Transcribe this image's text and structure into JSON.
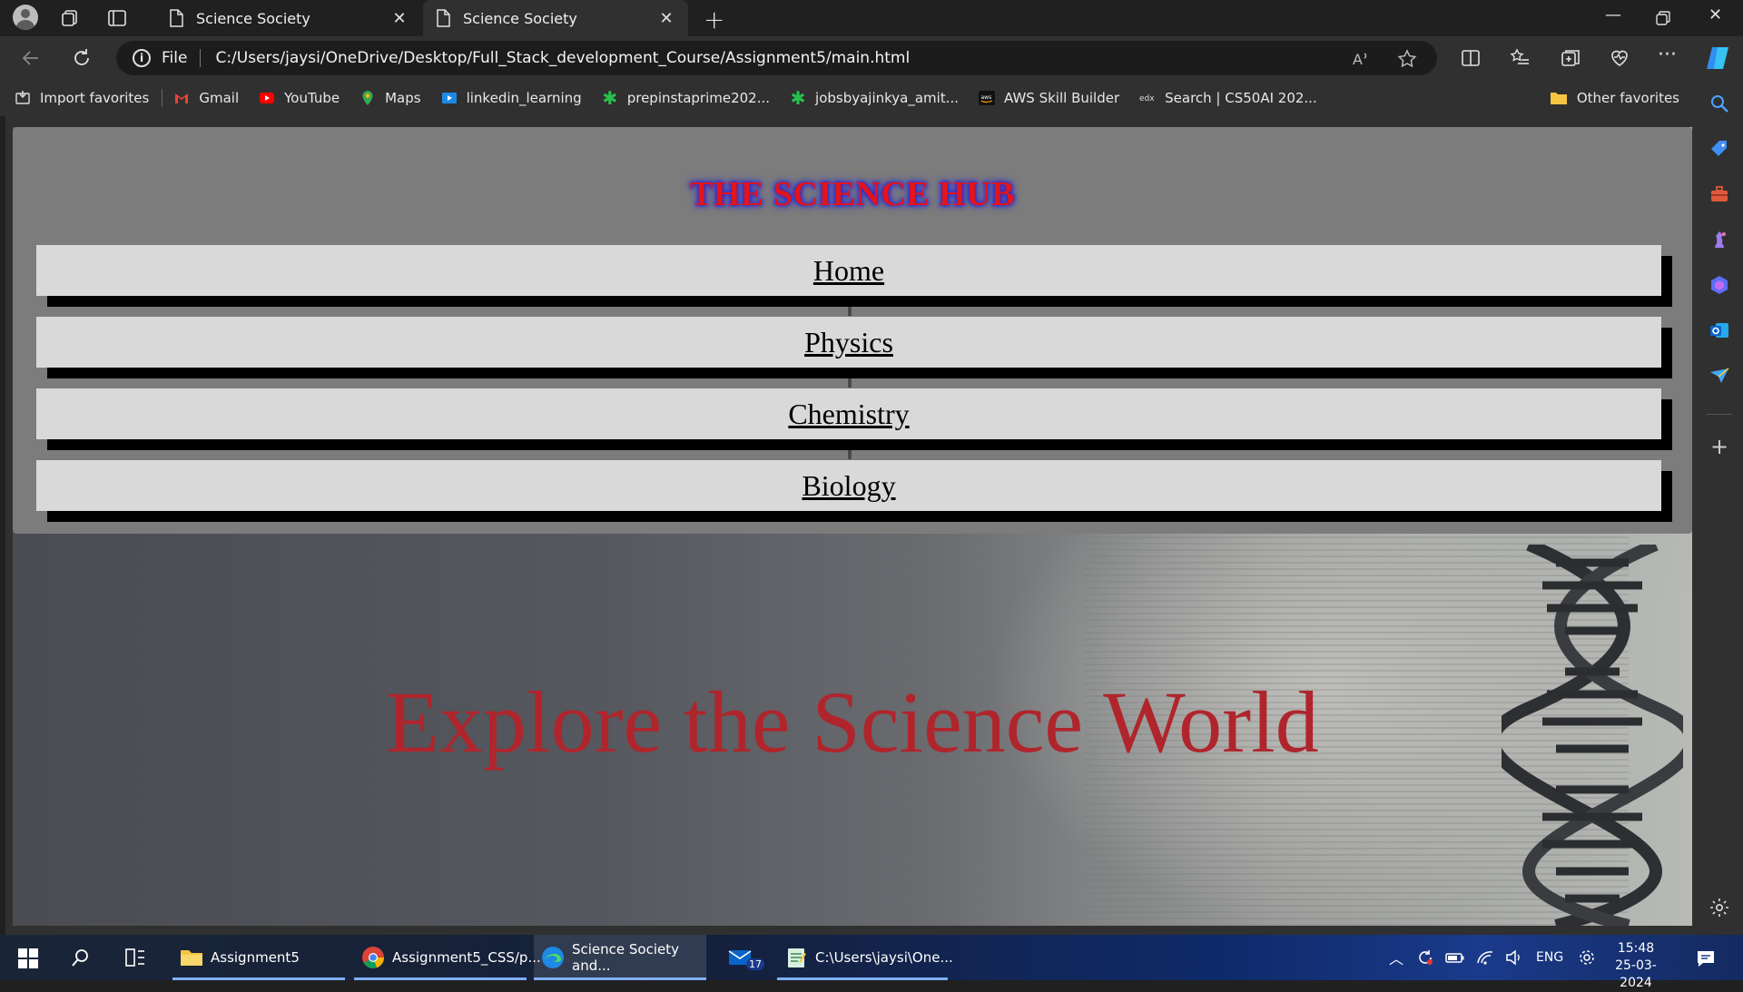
{
  "tabs": [
    {
      "title": "Science Society",
      "active": false
    },
    {
      "title": "Science Society",
      "active": true
    }
  ],
  "address": {
    "scheme_label": "File",
    "url": "C:/Users/jaysi/OneDrive/Desktop/Full_Stack_development_Course/Assignment5/main.html"
  },
  "favorites": {
    "items": [
      {
        "label": "Import favorites",
        "icon": "import-icon"
      },
      {
        "label": "Gmail",
        "icon": "gmail-icon"
      },
      {
        "label": "YouTube",
        "icon": "youtube-icon"
      },
      {
        "label": "Maps",
        "icon": "maps-pin-icon"
      },
      {
        "label": "linkedin_learning",
        "icon": "linkedin-learning-icon"
      },
      {
        "label": "prepinstaprime202...",
        "icon": "prepinsta-icon"
      },
      {
        "label": "jobsbyajinkya_amit...",
        "icon": "jobs-icon"
      },
      {
        "label": "AWS Skill Builder",
        "icon": "aws-icon"
      },
      {
        "label": "Search | CS50AI 202...",
        "icon": "edx-icon"
      }
    ],
    "other": "Other favorites"
  },
  "page": {
    "title": "THE SCIENCE HUB",
    "nav": [
      "Home",
      "Physics",
      "Chemistry",
      "Biology"
    ],
    "hero": "Explore the Science World"
  },
  "colors": {
    "title_red": "#e3141a",
    "title_glow": "#1e20c8",
    "hero_red": "#b0252c",
    "header_bg": "#7c7c7c",
    "nav_bg": "#d9d9d9"
  },
  "taskbar": {
    "apps": [
      {
        "label": "Assignment5",
        "icon": "folder-icon"
      },
      {
        "label": "Assignment5_CSS/p...",
        "icon": "chrome-icon"
      },
      {
        "label": "Science Society and...",
        "icon": "edge-icon"
      },
      {
        "label": "",
        "icon": "mail-icon",
        "badge": "17"
      },
      {
        "label": "C:\\Users\\jaysi\\One...",
        "icon": "notepad-icon"
      }
    ],
    "language": "ENG",
    "time": "15:48",
    "date": "25-03-2024"
  }
}
